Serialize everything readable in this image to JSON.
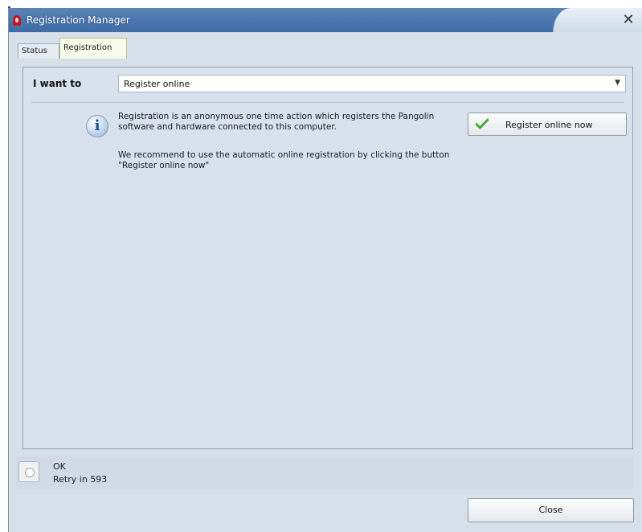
{
  "window": {
    "title": "Registration Manager",
    "close_glyph": "✕",
    "icon": "app-icon"
  },
  "tabs": [
    {
      "label": "Status",
      "active": false
    },
    {
      "label": "Registration",
      "active": true
    }
  ],
  "registration": {
    "i_want_to_label": "I want to",
    "select": {
      "value": "Register online",
      "arrow": "▼"
    },
    "info_icon_glyph": "i",
    "info_paragraph_1": "Registration is an anonymous one time action which registers the Pangolin software and hardware connected to this computer.",
    "info_paragraph_2": "We recommend to use the automatic online registration by clicking the button \"Register online now\"",
    "register_button_label": "Register online now"
  },
  "status": {
    "line1": "OK",
    "line2": "Retry in 593"
  },
  "footer": {
    "close_label": "Close"
  },
  "colors": {
    "title_bar": "#4a76ae",
    "panel_bg": "#d9e2ec",
    "check_green": "#4aa832",
    "active_tab_bg": "#f8fbe9"
  }
}
